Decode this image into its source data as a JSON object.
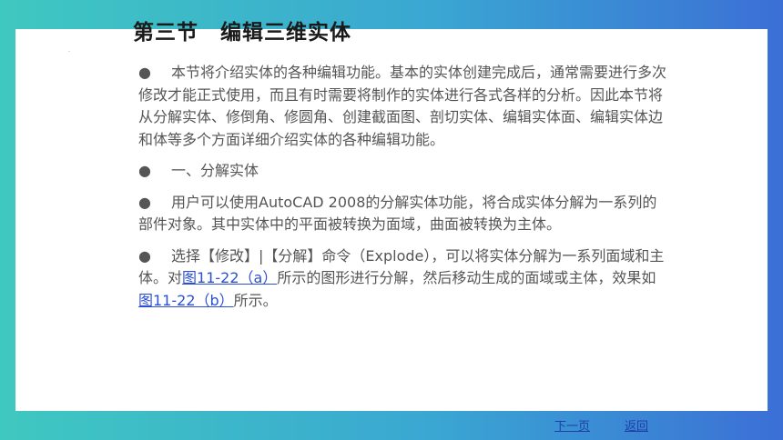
{
  "slide": {
    "title": "第三节　编辑三维实体",
    "paragraphs": [
      {
        "bullet": "●",
        "text": "本节将介绍实体的各种编辑功能。基本的实体创建完成后，通常需要进行多次修改才能正式使用，而且有时需要将制作的实体进行各式各样的分析。因此本节将从分解实体、修倒角、修圆角、创建截面图、剖切实体、编辑实体面、编辑实体边和体等多个方面详细介绍实体的各种编辑功能。"
      },
      {
        "bullet": "●",
        "text": "一、分解实体"
      },
      {
        "bullet": "●",
        "text": "用户可以使用AutoCAD 2008的分解实体功能，将合成实体分解为一系列的部件对象。其中实体中的平面被转换为面域，曲面被转换为主体。"
      },
      {
        "bullet": "●",
        "text_before": "选择【修改】|【分解】命令（Explode），可以将实体分解为一系列面域和主体。对",
        "link1": "图11-22（a）",
        "text_middle": "所示的图形进行分解，然后移动生成的面域或主体，效果如",
        "link2": "图11-22（b）",
        "text_after": "所示。"
      }
    ]
  },
  "nav": {
    "next_label": "下一页",
    "back_label": "返回"
  },
  "colors": {
    "link": "#2b4fd6",
    "background_gradient_start": "#3fc8c0",
    "background_gradient_end": "#3b6fd6"
  }
}
